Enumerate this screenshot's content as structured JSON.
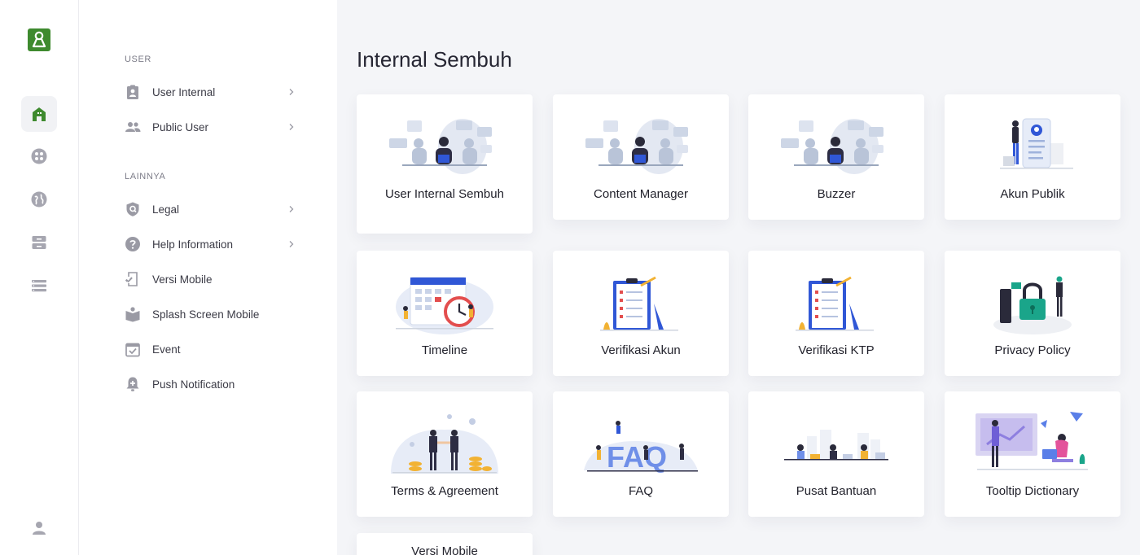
{
  "app": {
    "brand_color": "#3e8a2e",
    "logo_icon": "pin-logo-icon"
  },
  "rail": {
    "items": [
      {
        "icon": "home-icon",
        "active": true
      },
      {
        "icon": "dashboard-circle-icon",
        "active": false
      },
      {
        "icon": "globe-icon",
        "active": false
      },
      {
        "icon": "inbox-icon",
        "active": false
      },
      {
        "icon": "list-icon",
        "active": false
      }
    ],
    "profile_icon": "user-icon"
  },
  "menu": {
    "sections": [
      {
        "heading": "USER",
        "items": [
          {
            "label": "User Internal",
            "icon": "id-badge-icon",
            "has_chevron": true
          },
          {
            "label": "Public User",
            "icon": "people-icon",
            "has_chevron": true
          }
        ]
      },
      {
        "heading": "LAINNYA",
        "items": [
          {
            "label": "Legal",
            "icon": "shield-icon",
            "has_chevron": true
          },
          {
            "label": "Help Information",
            "icon": "help-icon",
            "has_chevron": true
          },
          {
            "label": "Versi Mobile",
            "icon": "mobile-check-icon",
            "has_chevron": false
          },
          {
            "label": "Splash Screen Mobile",
            "icon": "book-icon",
            "has_chevron": false
          },
          {
            "label": "Event",
            "icon": "calendar-check-icon",
            "has_chevron": false
          },
          {
            "label": "Push Notification",
            "icon": "bell-plus-icon",
            "has_chevron": false
          }
        ]
      }
    ]
  },
  "main": {
    "title": "Internal Sembuh",
    "cards": [
      {
        "label": "User Internal Sembuh",
        "illustration": "team-at-desk-illustration"
      },
      {
        "label": "Content Manager",
        "illustration": "team-at-desk-illustration"
      },
      {
        "label": "Buzzer",
        "illustration": "team-at-desk-illustration"
      },
      {
        "label": "Akun Publik",
        "illustration": "profile-card-illustration"
      },
      {
        "label": "Timeline",
        "illustration": "calendar-clock-illustration"
      },
      {
        "label": "Verifikasi Akun",
        "illustration": "checklist-illustration"
      },
      {
        "label": "Verifikasi KTP",
        "illustration": "checklist-illustration"
      },
      {
        "label": "Privacy Policy",
        "illustration": "padlock-illustration"
      },
      {
        "label": "Terms & Agreement",
        "illustration": "handshake-illustration"
      },
      {
        "label": "FAQ",
        "illustration": "faq-letters-illustration"
      },
      {
        "label": "Pusat Bantuan",
        "illustration": "helpdesk-illustration"
      },
      {
        "label": "Tooltip Dictionary",
        "illustration": "presentation-illustration"
      },
      {
        "label": "Versi Mobile",
        "illustration": ""
      }
    ]
  }
}
